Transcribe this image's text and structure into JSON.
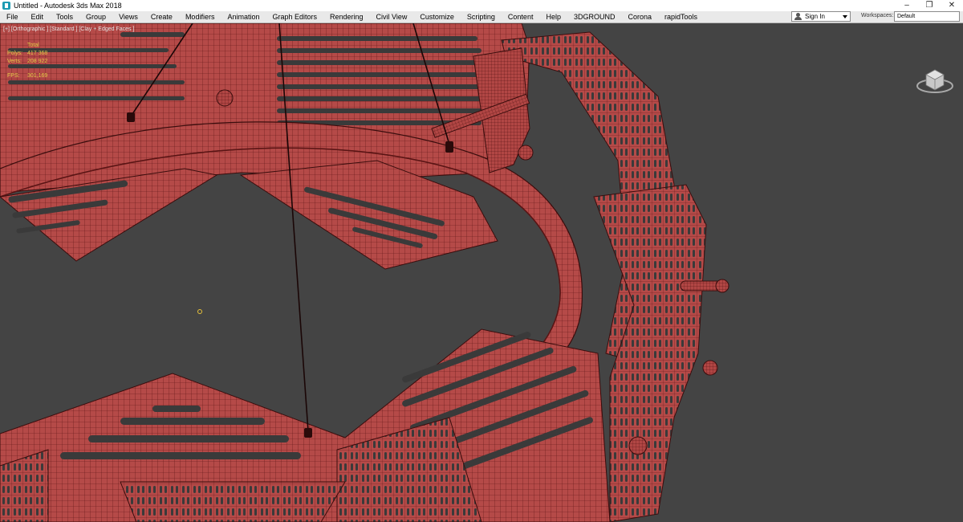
{
  "window": {
    "title": "Untitled - Autodesk 3ds Max 2018",
    "controls": [
      "–",
      "❐",
      "✕"
    ]
  },
  "menu": [
    "File",
    "Edit",
    "Tools",
    "Group",
    "Views",
    "Create",
    "Modifiers",
    "Animation",
    "Graph Editors",
    "Rendering",
    "Civil View",
    "Customize",
    "Scripting",
    "Content",
    "Help",
    "3DGROUND",
    "Corona",
    "rapidTools"
  ],
  "account": {
    "sign_in": "Sign In"
  },
  "workspaces": {
    "label": "Workspaces:",
    "value": "Default"
  },
  "viewport": {
    "label": "[+] [Orthographic ] [Standard ] [Clay + Edged Faces ]",
    "stats": {
      "header": "Total",
      "polys_label": "Polys:",
      "polys_value": "417 368",
      "verts_label": "Verts:",
      "verts_value": "208 922",
      "fps_label": "FPS:",
      "fps_value": "301,169"
    }
  },
  "colors": {
    "viewport_bg": "#444444",
    "mesh_fill": "#b54a48",
    "mesh_wire": "#5a1414",
    "stats_text": "#e3c948"
  },
  "icons": [
    "app-icon",
    "user-icon",
    "chevron-down-icon",
    "viewcube-icon",
    "pivot-icon"
  ]
}
